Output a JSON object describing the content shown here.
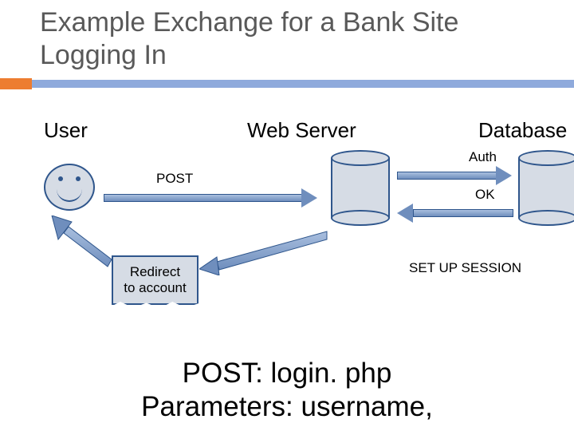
{
  "title": {
    "line1": "Example Exchange for a Bank Site",
    "line2": "Logging In"
  },
  "columns": {
    "user": "User",
    "webserver": "Web Server",
    "database": "Database"
  },
  "arrows": {
    "post": "POST",
    "auth": "Auth",
    "ok": "OK"
  },
  "boxes": {
    "redirect_line1": "Redirect",
    "redirect_line2": "to account",
    "session": "SET UP SESSION"
  },
  "footer": {
    "line1": "POST: login. php",
    "line2": "Parameters: username,"
  }
}
